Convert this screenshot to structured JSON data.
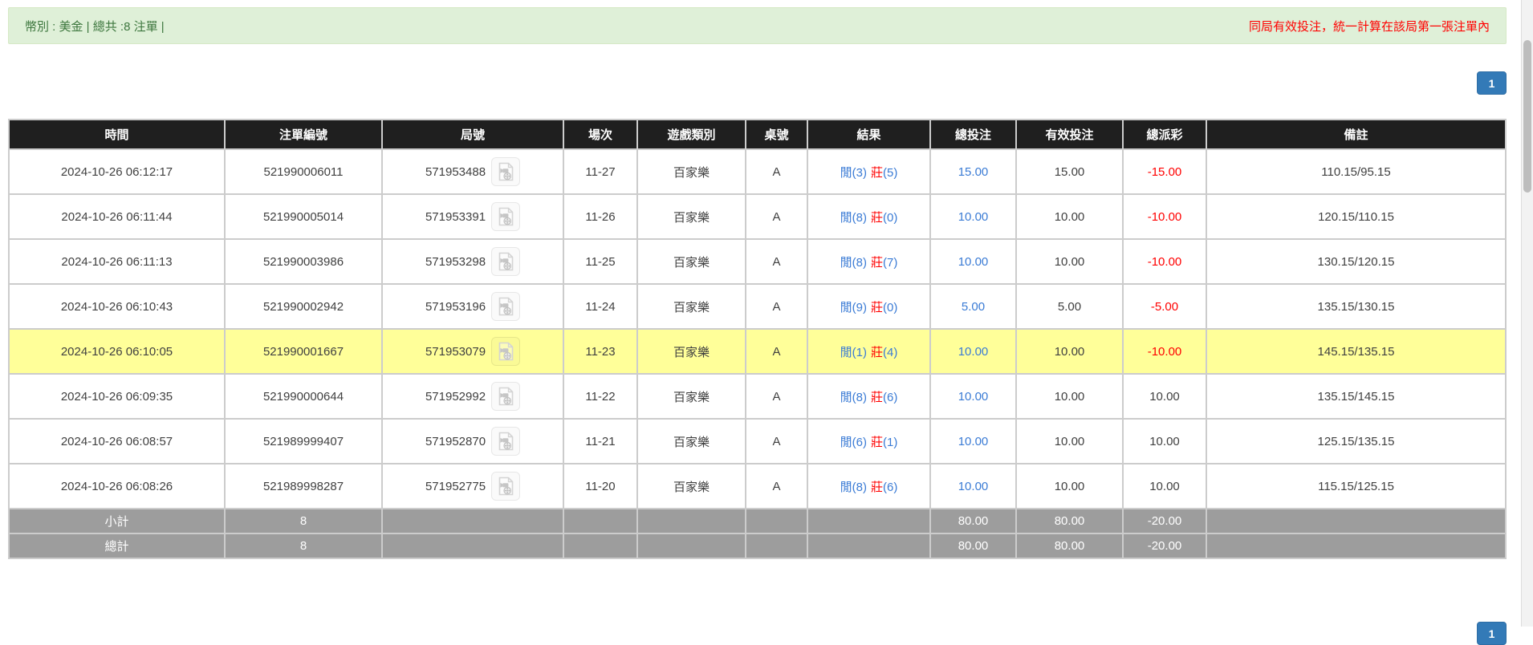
{
  "info_bar": {
    "summary_text": "幣別 : 美金 | 總共 :8 注單 |",
    "notice_text": "同局有效投注，統一計算在該局第一張注單內"
  },
  "pagination": {
    "current_page": "1"
  },
  "colors": {
    "accent_blue": "#337ab7",
    "link_blue": "#3a7bd5",
    "negative_red": "#ff0000",
    "highlight_yellow": "#ffff99",
    "header_dark": "#1f1f1f",
    "summary_gray": "#9d9d9d",
    "infobar_green_bg": "#dff0d8",
    "infobar_green_text": "#3c763d"
  },
  "icons": {
    "video_replay": "video-replay-icon"
  },
  "table": {
    "headers": [
      "時間",
      "注單編號",
      "局號",
      "場次",
      "遊戲類別",
      "桌號",
      "結果",
      "總投注",
      "有效投注",
      "總派彩",
      "備註"
    ],
    "rows": [
      {
        "time": "2024-10-26 06:12:17",
        "bet_number": "521990006011",
        "round_number": "571953488",
        "session": "11-27",
        "game_type": "百家樂",
        "table_code": "A",
        "result_player": "閒(3)",
        "result_banker": "莊",
        "result_banker_score": "(5)",
        "total_bet": "15.00",
        "valid_bet": "15.00",
        "payout": "-15.00",
        "remark": "110.15/95.15",
        "highlighted": false
      },
      {
        "time": "2024-10-26 06:11:44",
        "bet_number": "521990005014",
        "round_number": "571953391",
        "session": "11-26",
        "game_type": "百家樂",
        "table_code": "A",
        "result_player": "閒(8)",
        "result_banker": "莊",
        "result_banker_score": "(0)",
        "total_bet": "10.00",
        "valid_bet": "10.00",
        "payout": "-10.00",
        "remark": "120.15/110.15",
        "highlighted": false
      },
      {
        "time": "2024-10-26 06:11:13",
        "bet_number": "521990003986",
        "round_number": "571953298",
        "session": "11-25",
        "game_type": "百家樂",
        "table_code": "A",
        "result_player": "閒(8)",
        "result_banker": "莊",
        "result_banker_score": "(7)",
        "total_bet": "10.00",
        "valid_bet": "10.00",
        "payout": "-10.00",
        "remark": "130.15/120.15",
        "highlighted": false
      },
      {
        "time": "2024-10-26 06:10:43",
        "bet_number": "521990002942",
        "round_number": "571953196",
        "session": "11-24",
        "game_type": "百家樂",
        "table_code": "A",
        "result_player": "閒(9)",
        "result_banker": "莊",
        "result_banker_score": "(0)",
        "total_bet": "5.00",
        "valid_bet": "5.00",
        "payout": "-5.00",
        "remark": "135.15/130.15",
        "highlighted": false
      },
      {
        "time": "2024-10-26 06:10:05",
        "bet_number": "521990001667",
        "round_number": "571953079",
        "session": "11-23",
        "game_type": "百家樂",
        "table_code": "A",
        "result_player": "閒(1)",
        "result_banker": "莊",
        "result_banker_score": "(4)",
        "total_bet": "10.00",
        "valid_bet": "10.00",
        "payout": "-10.00",
        "remark": "145.15/135.15",
        "highlighted": true
      },
      {
        "time": "2024-10-26 06:09:35",
        "bet_number": "521990000644",
        "round_number": "571952992",
        "session": "11-22",
        "game_type": "百家樂",
        "table_code": "A",
        "result_player": "閒(8)",
        "result_banker": "莊",
        "result_banker_score": "(6)",
        "total_bet": "10.00",
        "valid_bet": "10.00",
        "payout": "10.00",
        "remark": "135.15/145.15",
        "highlighted": false
      },
      {
        "time": "2024-10-26 06:08:57",
        "bet_number": "521989999407",
        "round_number": "571952870",
        "session": "11-21",
        "game_type": "百家樂",
        "table_code": "A",
        "result_player": "閒(6)",
        "result_banker": "莊",
        "result_banker_score": "(1)",
        "total_bet": "10.00",
        "valid_bet": "10.00",
        "payout": "10.00",
        "remark": "125.15/135.15",
        "highlighted": false
      },
      {
        "time": "2024-10-26 06:08:26",
        "bet_number": "521989998287",
        "round_number": "571952775",
        "session": "11-20",
        "game_type": "百家樂",
        "table_code": "A",
        "result_player": "閒(8)",
        "result_banker": "莊",
        "result_banker_score": "(6)",
        "total_bet": "10.00",
        "valid_bet": "10.00",
        "payout": "10.00",
        "remark": "115.15/125.15",
        "highlighted": false
      }
    ],
    "subtotal": {
      "label": "小計",
      "count": "8",
      "total_bet": "80.00",
      "valid_bet": "80.00",
      "payout": "-20.00"
    },
    "total": {
      "label": "總計",
      "count": "8",
      "total_bet": "80.00",
      "valid_bet": "80.00",
      "payout": "-20.00"
    }
  }
}
